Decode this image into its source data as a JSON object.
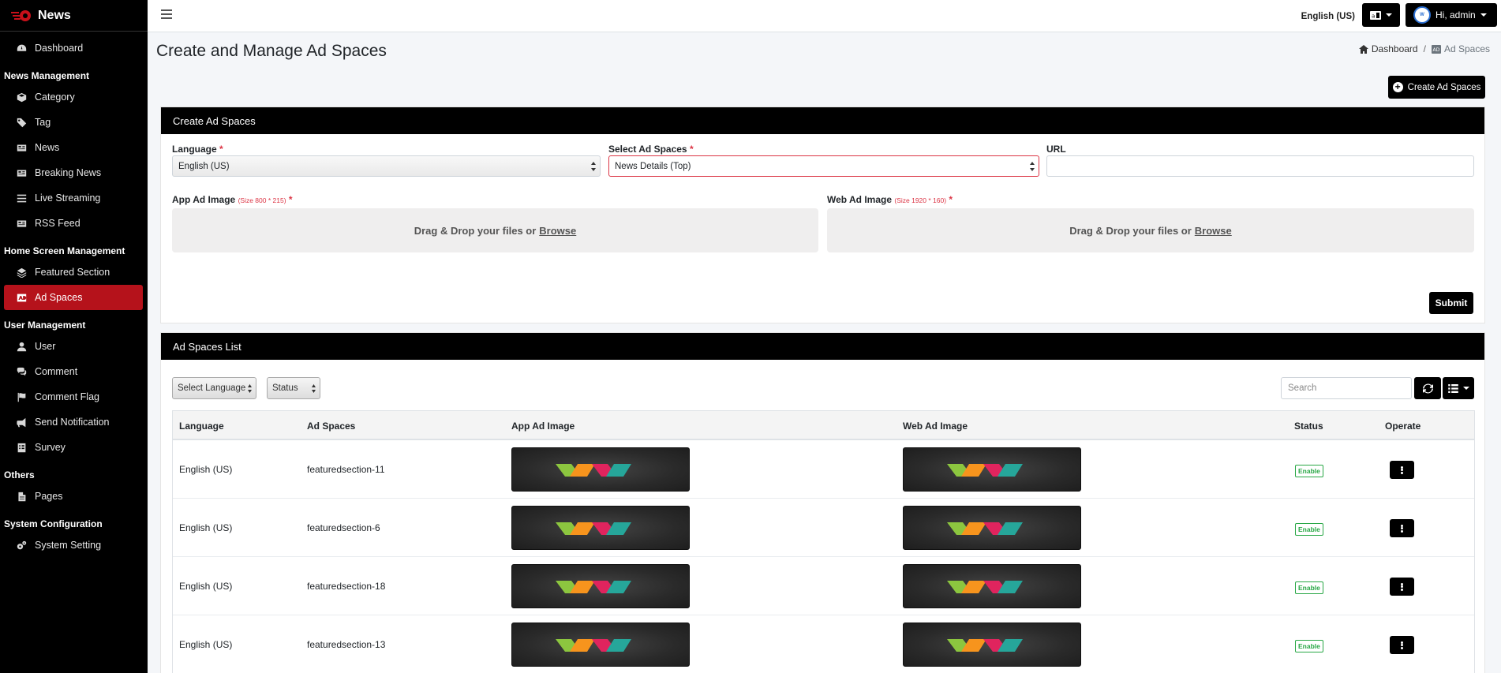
{
  "brand": {
    "name": "News",
    "accent": "#b5121b"
  },
  "sidebar": {
    "dashboard": "Dashboard",
    "news_management_header": "News Management",
    "category": "Category",
    "tag": "Tag",
    "news": "News",
    "breaking_news": "Breaking News",
    "live_streaming": "Live Streaming",
    "rss_feed": "RSS Feed",
    "home_screen_header": "Home Screen Management",
    "featured_section": "Featured Section",
    "ad_spaces": "Ad Spaces",
    "user_management_header": "User Management",
    "user": "User",
    "comment": "Comment",
    "comment_flag": "Comment Flag",
    "send_notification": "Send Notification",
    "survey": "Survey",
    "others_header": "Others",
    "pages": "Pages",
    "system_config_header": "System Configuration",
    "system_setting": "System Setting"
  },
  "topbar": {
    "language": "English (US)",
    "user_greeting": "Hi, admin"
  },
  "page": {
    "title": "Create and Manage Ad Spaces",
    "breadcrumb_home": "Dashboard",
    "breadcrumb_current": "Ad Spaces",
    "create_button": "Create Ad Spaces"
  },
  "form": {
    "header": "Create Ad Spaces",
    "language_label": "Language",
    "language_value": "English (US)",
    "ad_space_label": "Select Ad Spaces",
    "ad_space_value": "News Details (Top)",
    "url_label": "URL",
    "app_image_label": "App Ad Image",
    "app_image_hint": "(Size 800 * 215)",
    "web_image_label": "Web Ad Image",
    "web_image_hint": "(Size 1920 * 160)",
    "drop_text": "Drag & Drop your files or",
    "browse": "Browse",
    "required_mark": "*",
    "submit": "Submit"
  },
  "list": {
    "header": "Ad Spaces List",
    "filter_language": "Select Language",
    "filter_status": "Status",
    "search_placeholder": "Search",
    "columns": [
      "Language",
      "Ad Spaces",
      "App Ad Image",
      "Web Ad Image",
      "Status",
      "Operate"
    ],
    "rows": [
      {
        "language": "English (US)",
        "ad_space": "featuredsection-11",
        "status": "Enable"
      },
      {
        "language": "English (US)",
        "ad_space": "featuredsection-6",
        "status": "Enable"
      },
      {
        "language": "English (US)",
        "ad_space": "featuredsection-18",
        "status": "Enable"
      },
      {
        "language": "English (US)",
        "ad_space": "featuredsection-13",
        "status": "Enable"
      }
    ]
  }
}
